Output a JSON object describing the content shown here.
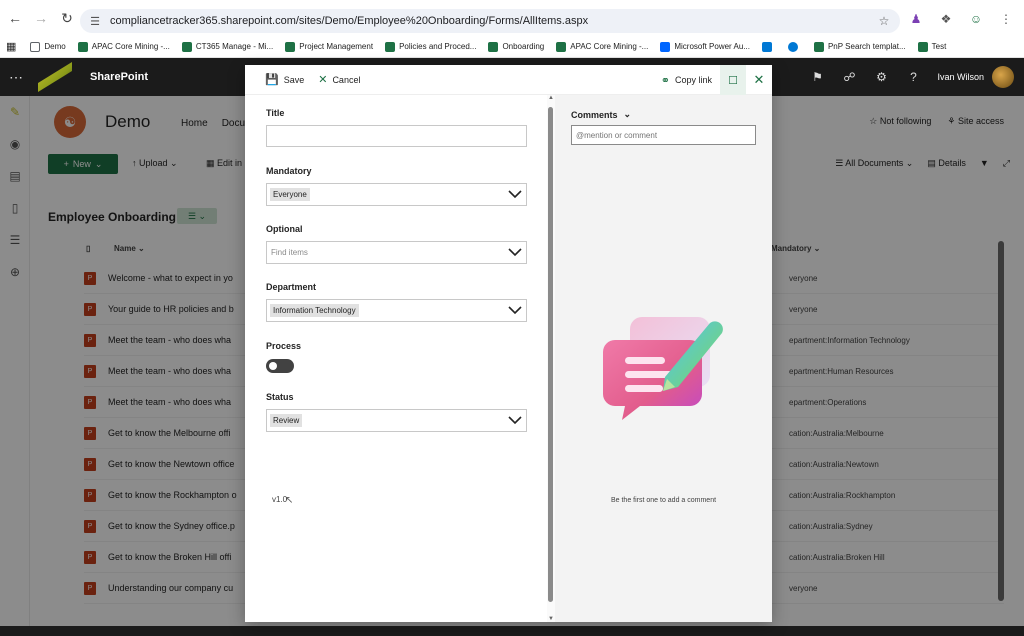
{
  "browser": {
    "url": "compliancetracker365.sharepoint.com/sites/Demo/Employee%20Onboarding/Forms/AllItems.aspx",
    "bookmarks": [
      {
        "label": "Demo",
        "color": "#5f6368"
      },
      {
        "label": "APAC Core Mining -...",
        "color": "#1e7145"
      },
      {
        "label": "CT365 Manage - Mi...",
        "color": "#1e7145"
      },
      {
        "label": "Project Management",
        "color": "#1e7145"
      },
      {
        "label": "Policies and Proced...",
        "color": "#1e7145"
      },
      {
        "label": "Onboarding",
        "color": "#1e7145"
      },
      {
        "label": "APAC Core Mining -...",
        "color": "#1e7145"
      },
      {
        "label": "Microsoft Power Au...",
        "color": "#0066ff"
      },
      {
        "label": "",
        "color": "#0078d4"
      },
      {
        "label": "",
        "color": "#0078d4"
      },
      {
        "label": "PnP Search templat...",
        "color": "#1e7145"
      },
      {
        "label": "Test",
        "color": "#1e7145"
      }
    ]
  },
  "suite": {
    "app_name": "SharePoint",
    "user_name": "Ivan Wilson"
  },
  "site": {
    "name": "Demo",
    "nav": [
      "Home",
      "Docu"
    ],
    "not_following": "Not following",
    "site_access": "Site access",
    "new_label": "New",
    "upload_label": "Upload",
    "edit_label": "Edit in",
    "all_documents": "All Documents",
    "details": "Details",
    "list_title": "Employee Onboarding",
    "col_name": "Name",
    "col_mandatory": "Mandatory",
    "rows": [
      {
        "name": "Welcome - what to expect in yo",
        "mandatory": "veryone"
      },
      {
        "name": "Your guide to HR policies and b",
        "mandatory": "veryone"
      },
      {
        "name": "Meet the team - who does wha",
        "mandatory": "epartment:Information Technology"
      },
      {
        "name": "Meet the team - who does wha",
        "mandatory": "epartment:Human Resources"
      },
      {
        "name": "Meet the team - who does wha",
        "mandatory": "epartment:Operations"
      },
      {
        "name": "Get to know the Melbourne offi",
        "mandatory": "cation:Australia:Melbourne"
      },
      {
        "name": "Get to know the Newtown office",
        "mandatory": "cation:Australia:Newtown"
      },
      {
        "name": "Get to know the Rockhampton o",
        "mandatory": "cation:Australia:Rockhampton"
      },
      {
        "name": "Get to know the Sydney office.p",
        "mandatory": "cation:Australia:Sydney"
      },
      {
        "name": "Get to know the Broken Hill offi",
        "mandatory": "cation:Australia:Broken Hill"
      },
      {
        "name": "Understanding our company cu",
        "mandatory": "veryone"
      }
    ]
  },
  "panel": {
    "save_label": "Save",
    "cancel_label": "Cancel",
    "copy_link_label": "Copy link",
    "fields": {
      "title_label": "Title",
      "title_value": "",
      "mandatory_label": "Mandatory",
      "mandatory_value": "Everyone",
      "optional_label": "Optional",
      "optional_placeholder": "Find items",
      "department_label": "Department",
      "department_value": "Information Technology",
      "process_label": "Process",
      "process_on": false,
      "status_label": "Status",
      "status_value": "Review"
    },
    "version": "v1.0",
    "comments": {
      "title": "Comments",
      "placeholder": "@mention or comment",
      "empty_text": "Be the first one to add a comment"
    }
  },
  "colors": {
    "accent": "#1e7145",
    "suite_bg": "#1b1b1b"
  }
}
